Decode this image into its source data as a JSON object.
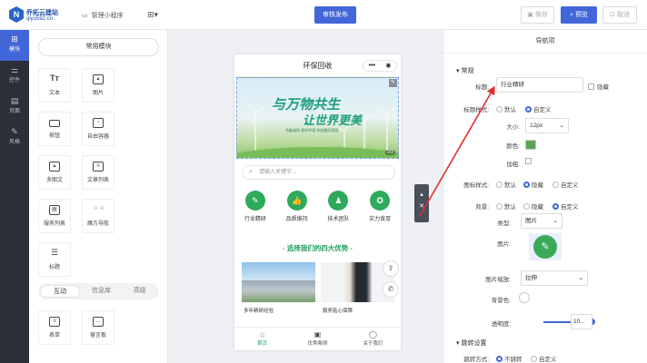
{
  "header": {
    "brand_name": "乔拓云建站",
    "brand_url": "qiyu592.cn",
    "manage_label": "管理小程序",
    "publish_label": "审核发布",
    "save_label": "保存",
    "preview_label": "预览",
    "cancel_label": "取消"
  },
  "left_nav": [
    {
      "label": "模块",
      "icon": "plus-square-icon"
    },
    {
      "label": "控件",
      "icon": "sliders-icon"
    },
    {
      "label": "页面",
      "icon": "pages-icon"
    },
    {
      "label": "风格",
      "icon": "brush-icon"
    }
  ],
  "modules": {
    "header": "常用模块",
    "items": [
      "文本",
      "图片",
      "按钮",
      "自由容器",
      "多图文",
      "文章列表",
      "服务列表",
      "魔方导航",
      "标题"
    ],
    "tabs": [
      "互动",
      "信息库",
      "高级"
    ],
    "interactive_items": [
      "表单",
      "留言板"
    ]
  },
  "phone": {
    "title": "环保回收",
    "capsule": [
      "•••",
      "◉"
    ],
    "banner_title1": "与万物共生",
    "banner_title2": "让世界更美",
    "banner_sub": "节能减排 保护环境 共创美好家园",
    "banner_page": "2/2",
    "search_placeholder": "请输入关键字...",
    "categories": [
      "行业精研",
      "品质维持",
      "技术团队",
      "实力背厚"
    ],
    "advantages": "- 选择我们的四大优势 -",
    "cards": [
      "多年精研经验",
      "服务贴心保障"
    ],
    "bottom_nav": [
      "首页",
      "优秀案例",
      "关于我们"
    ]
  },
  "props": {
    "title": "导航项",
    "section_general": "常规",
    "title_label": "标题:",
    "title_value": "行业精研",
    "hide_label": "隐藏",
    "title_style_label": "标题样式:",
    "default_label": "默认",
    "custom_label": "自定义",
    "size_label": "大小:",
    "size_value": "12px",
    "color_label": "颜色:",
    "bold_label": "加粗:",
    "icon_style_label": "图标样式:",
    "background_label": "背景:",
    "type_label": "类型:",
    "type_value": "图片",
    "image_label": "图片:",
    "image_scale_label": "图片缩放:",
    "image_scale_value": "拉伸",
    "bgcolor_label": "背景色:",
    "opacity_label": "透明度:",
    "opacity_value": "10...",
    "section_jump": "跳转设置",
    "jump_label": "跳转方式:",
    "no_jump": "不跳转",
    "accent": "#4167d9",
    "swatch_color": "#5ba354"
  }
}
